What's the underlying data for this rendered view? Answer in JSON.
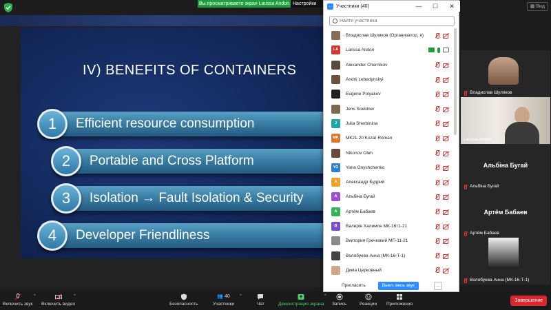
{
  "banner": {
    "viewing_text": "Вы просматриваете экран Larissa Andon",
    "settings_label": "Настройки",
    "view_label": "Вид"
  },
  "slide": {
    "title": "IV) BENEFITS OF CONTAINERS",
    "items": [
      {
        "num": "1",
        "text": "Efficient resource consumption"
      },
      {
        "num": "2",
        "text": "Portable and Cross Platform"
      },
      {
        "num": "3",
        "text": "Isolation → Fault Isolation & Security"
      },
      {
        "num": "4",
        "text": "Developer Friendliness"
      }
    ]
  },
  "participants_window": {
    "title": "Участники (40)",
    "search_placeholder": "Найти участника",
    "participants": [
      {
        "name": "Владислав Шуляков (Организатор, я)",
        "avatar_text": "",
        "avatar_color": "#8a6b55",
        "status": "muted"
      },
      {
        "name": "Larissa Andon",
        "avatar_text": "LA",
        "avatar_color": "#d9372e",
        "status": "sharing"
      },
      {
        "name": "Alexander Chernikov",
        "avatar_text": "",
        "avatar_color": "#5a4a3a",
        "status": "muted"
      },
      {
        "name": "Andrii Lebedynskyi",
        "avatar_text": "",
        "avatar_color": "#6a5040",
        "status": "muted"
      },
      {
        "name": "Eugene Polyakov",
        "avatar_text": "",
        "avatar_color": "#222222",
        "status": "muted"
      },
      {
        "name": "Jens Soeldner",
        "avatar_text": "",
        "avatar_color": "#7a6a50",
        "status": "muted"
      },
      {
        "name": "Julia Sherbinina",
        "avatar_text": "J",
        "avatar_color": "#22a3a6",
        "status": "muted"
      },
      {
        "name": "МК21-20 Kozar Roman",
        "avatar_text": "MK",
        "avatar_color": "#e0742a",
        "status": "muted"
      },
      {
        "name": "Nikonov Oleh",
        "avatar_text": "",
        "avatar_color": "#6a4a3a",
        "status": "muted"
      },
      {
        "name": "Yana Onyshchenko",
        "avatar_text": "YO",
        "avatar_color": "#2f7fd1",
        "status": "muted"
      },
      {
        "name": "Александр Будрий",
        "avatar_text": "А",
        "avatar_color": "#f0a12a",
        "status": "muted"
      },
      {
        "name": "Альбіна Бугай",
        "avatar_text": "А",
        "avatar_color": "#9b4fd1",
        "status": "muted"
      },
      {
        "name": "Артём Бабаев",
        "avatar_text": "А",
        "avatar_color": "#33b257",
        "status": "muted"
      },
      {
        "name": "Валерія Халимон МК-16т1-21",
        "avatar_text": "В",
        "avatar_color": "#7a4fc7",
        "status": "muted"
      },
      {
        "name": "Виктория Гречкокий МП-11-21",
        "avatar_text": "",
        "avatar_color": "#8a8a8a",
        "status": "muted"
      },
      {
        "name": "Волобуева Анна (МК-16-Т-1)",
        "avatar_text": "",
        "avatar_color": "#444444",
        "status": "muted"
      },
      {
        "name": "Дима Церковный",
        "avatar_text": "",
        "avatar_color": "#cfa68a",
        "status": "muted"
      }
    ],
    "invite_label": "Пригласить",
    "mute_all_label": "Выкл. весь звук",
    "more_label": "..."
  },
  "video_tiles": [
    {
      "name": "Владислав Шуляков",
      "kind": "photo-man"
    },
    {
      "name": "Larissa Andon",
      "kind": "photo-woman"
    },
    {
      "name": "Альбіна Бугай",
      "big_name": "Альбіна Бугай",
      "kind": "name"
    },
    {
      "name": "Артём Бабаев",
      "big_name": "Артём Бабаев",
      "kind": "name"
    },
    {
      "name": "Волобуева Анна (МК-16-Т-1)",
      "kind": "photo-dark"
    }
  ],
  "toolbar": {
    "unmute_label": "Включить звук",
    "start_video_label": "Включить видео",
    "security_label": "Безопасность",
    "participants_label": "Участники",
    "participants_count": "40",
    "chat_label": "Чат",
    "share_label": "Демонстрация экрана",
    "record_label": "Запись",
    "reactions_label": "Реакции",
    "apps_label": "Приложения",
    "end_label": "Завершение"
  },
  "colors": {
    "zoom_blue": "#2d8cff",
    "share_green": "#1e9e3c",
    "end_red": "#d9272e"
  }
}
